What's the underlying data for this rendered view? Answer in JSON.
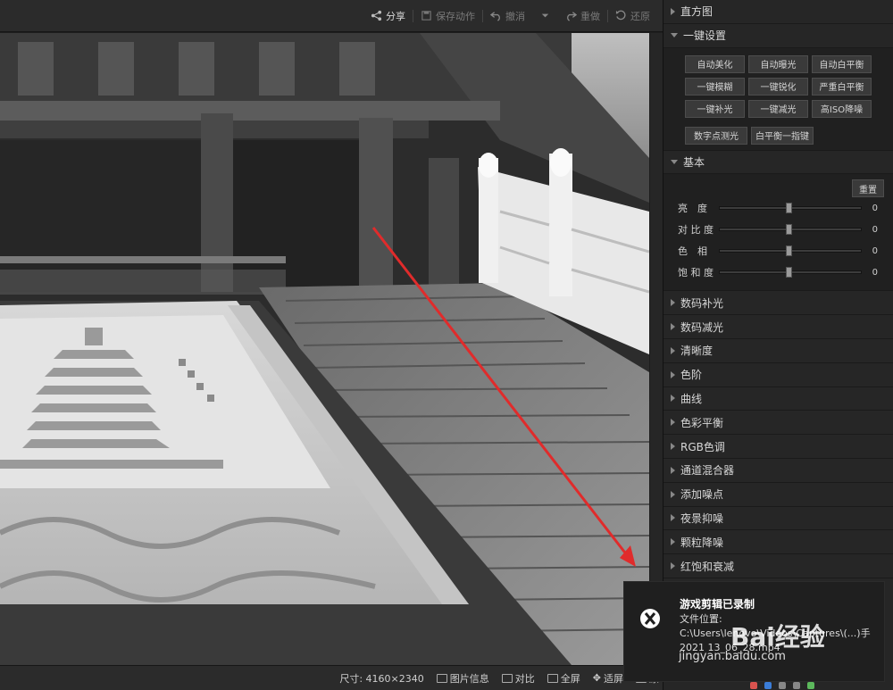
{
  "toolbar": {
    "share": "分享",
    "save_action": "保存动作",
    "undo": "撤消",
    "redo": "重做",
    "restore": "还原"
  },
  "status": {
    "size": "尺寸: 4160×2340",
    "image_info": "图片信息",
    "compare": "对比",
    "fullscreen": "全屏",
    "fit": "适屏",
    "original": "原"
  },
  "panel": {
    "histogram": "直方图",
    "oneclick_title": "一键设置",
    "oneclick_buttons": [
      "自动美化",
      "自动曝光",
      "自动白平衡",
      "一键模糊",
      "一键锐化",
      "严重白平衡",
      "一键补光",
      "一键减光",
      "高ISO降噪"
    ],
    "extra_buttons": [
      "数字点测光",
      "白平衡一指键"
    ],
    "basic_title": "基本",
    "reset": "重置",
    "sliders": [
      {
        "label": "亮　度",
        "value": "0"
      },
      {
        "label": "对 比 度",
        "value": "0"
      },
      {
        "label": "色　相",
        "value": "0"
      },
      {
        "label": "饱 和 度",
        "value": "0"
      }
    ],
    "sections": [
      "数码补光",
      "数码减光",
      "清晰度",
      "色阶",
      "曲线",
      "色彩平衡",
      "RGB色调",
      "通道混合器",
      "添加噪点",
      "夜景抑噪",
      "颗粒降噪",
      "红饱和衰减"
    ]
  },
  "toast": {
    "title": "游戏剪辑已录制",
    "body": "文件位置: C:\\Users\\lenovo\\Videos\\Captures\\(...)手 2021 13_06_28.mp4"
  },
  "watermark": {
    "logo": "Bai经验",
    "url": "jingyan.baidu.com"
  }
}
